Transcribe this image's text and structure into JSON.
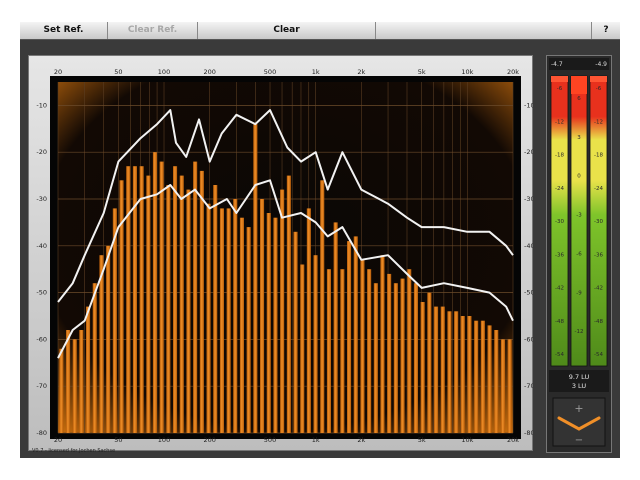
{
  "toolbar": {
    "set_ref": "Set Ref.",
    "clear_ref": "Clear Ref.",
    "clear": "Clear",
    "help": "?"
  },
  "status_text": "V0.7 - licensed for Jochen Sachse",
  "colors": {
    "bar": "#f08f28",
    "bar_dark": "#b35a08",
    "curve": "#f2f2f2",
    "plot_bg": "#0a0705",
    "glow": "#d4740e",
    "meter_green": "#7ec42a",
    "meter_yellow": "#e9e24a",
    "meter_red": "#e8311d"
  },
  "chart_data": {
    "type": "bar",
    "x_ticks": [
      "20",
      "50",
      "100",
      "200",
      "500",
      "1k",
      "2k",
      "5k",
      "10k",
      "20k"
    ],
    "y_ticks": [
      "-10",
      "-20",
      "-30",
      "-40",
      "-50",
      "-60",
      "-70",
      "-80"
    ],
    "ylim": [
      -80,
      -5
    ],
    "grid": true,
    "bars": [
      -62,
      -58,
      -60,
      -58,
      -53,
      -48,
      -42,
      -40,
      -32,
      -26,
      -23,
      -23,
      -23,
      -25,
      -20,
      -22,
      -27,
      -23,
      -25,
      -28,
      -22,
      -24,
      -31,
      -27,
      -32,
      -32,
      -30,
      -34,
      -36,
      -14,
      -30,
      -33,
      -34,
      -28,
      -25,
      -37,
      -44,
      -32,
      -42,
      -26,
      -45,
      -35,
      -45,
      -39,
      -38,
      -43,
      -45,
      -48,
      -42,
      -46,
      -48,
      -47,
      -45,
      -48,
      -52,
      -50,
      -53,
      -53,
      -54,
      -54,
      -55,
      -55,
      -56,
      -56,
      -57,
      -58,
      -60,
      -60
    ],
    "series": [
      {
        "name": "peak",
        "points": [
          [
            20,
            -52
          ],
          [
            25,
            -48
          ],
          [
            30,
            -42
          ],
          [
            40,
            -33
          ],
          [
            50,
            -22
          ],
          [
            70,
            -17
          ],
          [
            90,
            -14
          ],
          [
            110,
            -11
          ],
          [
            120,
            -18
          ],
          [
            140,
            -21
          ],
          [
            170,
            -13
          ],
          [
            200,
            -22
          ],
          [
            240,
            -16
          ],
          [
            300,
            -12
          ],
          [
            400,
            -14
          ],
          [
            500,
            -11
          ],
          [
            650,
            -19
          ],
          [
            800,
            -22
          ],
          [
            1000,
            -20
          ],
          [
            1200,
            -28
          ],
          [
            1500,
            -20
          ],
          [
            2000,
            -28
          ],
          [
            3000,
            -31
          ],
          [
            4000,
            -34
          ],
          [
            5000,
            -36
          ],
          [
            7000,
            -36
          ],
          [
            10000,
            -37
          ],
          [
            14000,
            -37
          ],
          [
            18000,
            -40
          ],
          [
            20000,
            -42
          ]
        ]
      },
      {
        "name": "average",
        "points": [
          [
            20,
            -64
          ],
          [
            25,
            -58
          ],
          [
            30,
            -56
          ],
          [
            40,
            -45
          ],
          [
            50,
            -36
          ],
          [
            70,
            -30
          ],
          [
            90,
            -29
          ],
          [
            110,
            -27
          ],
          [
            130,
            -30
          ],
          [
            160,
            -28
          ],
          [
            200,
            -32
          ],
          [
            260,
            -30
          ],
          [
            300,
            -33
          ],
          [
            400,
            -27
          ],
          [
            500,
            -26
          ],
          [
            600,
            -34
          ],
          [
            800,
            -33
          ],
          [
            1000,
            -35
          ],
          [
            1200,
            -38
          ],
          [
            1500,
            -36
          ],
          [
            2000,
            -43
          ],
          [
            3000,
            -42
          ],
          [
            4000,
            -46
          ],
          [
            5000,
            -49
          ],
          [
            7000,
            -48
          ],
          [
            10000,
            -49
          ],
          [
            14000,
            -50
          ],
          [
            18000,
            -53
          ],
          [
            20000,
            -56
          ]
        ]
      }
    ]
  },
  "meter": {
    "top_left": "-4.7",
    "top_right": "-4.9",
    "left_ticks": [
      "-6",
      "-12",
      "-18",
      "-24",
      "-30",
      "-36",
      "-42",
      "-48",
      "-54"
    ],
    "mid_ticks": [
      "6",
      "3",
      "0",
      "-3",
      "-6",
      "-9",
      "-12",
      "-15"
    ],
    "right_ticks": [
      "-6",
      "-12",
      "-18",
      "-24",
      "-30",
      "-36",
      "-42",
      "-48",
      "-54"
    ],
    "lu_value": "9.7 LU",
    "lu_value2": "3 LU",
    "plus_label": "+",
    "minus_label": "−",
    "left_level": -4.7,
    "right_level": -4.9,
    "center_level": 7
  }
}
